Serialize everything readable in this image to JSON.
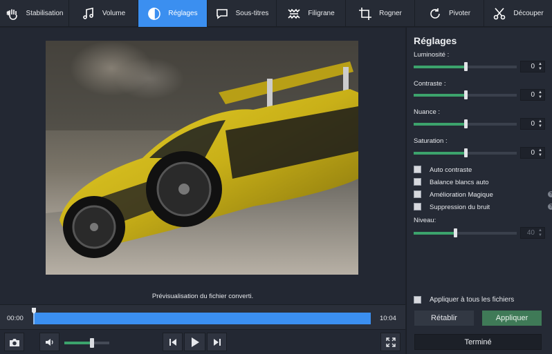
{
  "toolbar": {
    "tabs": [
      {
        "label": "Stabilisation",
        "icon": "hand-icon"
      },
      {
        "label": "Volume",
        "icon": "music-note-icon"
      },
      {
        "label": "Réglages",
        "icon": "contrast-icon",
        "active": true
      },
      {
        "label": "Sous-titres",
        "icon": "speech-bubble-icon"
      },
      {
        "label": "Filigrane",
        "icon": "watermark-icon"
      },
      {
        "label": "Rogner",
        "icon": "crop-icon"
      },
      {
        "label": "Pivoter",
        "icon": "rotate-icon"
      },
      {
        "label": "Découper",
        "icon": "scissors-icon"
      }
    ]
  },
  "preview": {
    "caption": "Prévisualisation du fichier converti.",
    "image_subject": "yellow sports car"
  },
  "timeline": {
    "start_time": "00:00",
    "end_time": "10:04",
    "progress": 0
  },
  "player": {
    "volume_level": 0.62
  },
  "settings": {
    "title": "Réglages",
    "sliders": [
      {
        "label": "Luminosité :",
        "value": "0",
        "level": 0.5
      },
      {
        "label": "Contraste :",
        "value": "0",
        "level": 0.5
      },
      {
        "label": "Nuance :",
        "value": "0",
        "level": 0.5
      },
      {
        "label": "Saturation :",
        "value": "0",
        "level": 0.5
      }
    ],
    "checkboxes": [
      {
        "label": "Auto contraste",
        "checked": false,
        "help": false
      },
      {
        "label": "Balance blancs auto",
        "checked": false,
        "help": false
      },
      {
        "label": "Amélioration Magique",
        "checked": false,
        "help": true
      },
      {
        "label": "Suppression du bruit",
        "checked": false,
        "help": true
      }
    ],
    "level_label": "Niveau:",
    "level_value": "40",
    "level_fraction": 0.4,
    "help_glyph": "?",
    "apply_all_label": "Appliquer à tous les fichiers",
    "reset_label": "Rétablir",
    "apply_label": "Appliquer",
    "done_label": "Terminé"
  },
  "colors": {
    "accent": "#3b8ff0",
    "slider_fill": "#3ca36c",
    "apply_button": "#3f7a57"
  }
}
